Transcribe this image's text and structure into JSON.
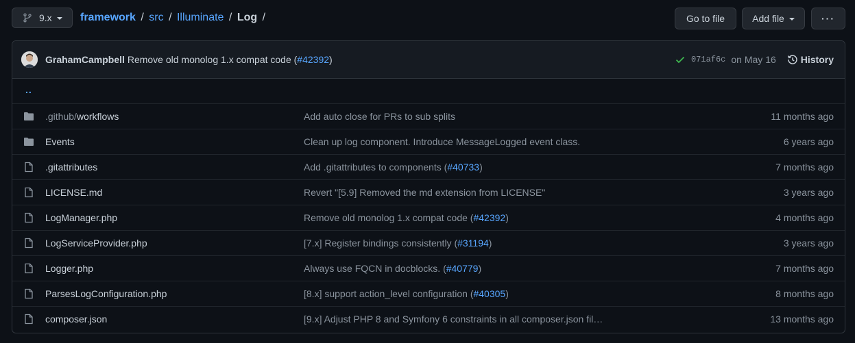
{
  "branch": {
    "label": "9.x",
    "icon": "git-branch-icon"
  },
  "breadcrumb": {
    "repo": "framework",
    "parts": [
      "src",
      "Illuminate"
    ],
    "current": "Log",
    "sep": "/"
  },
  "actions": {
    "go_to_file": "Go to file",
    "add_file": "Add file",
    "more": "···"
  },
  "commit": {
    "author": "GrahamCampbell",
    "message": "Remove old monolog 1.x compat code (",
    "pr": "#42392",
    "message_end": ")",
    "sha": "071af6c",
    "date": "on May 16",
    "history": "History"
  },
  "up": "..",
  "files": [
    {
      "type": "dir",
      "dim": ".github/",
      "name": "workflows",
      "msg": "Add auto close for PRs to sub splits",
      "pr": "",
      "msg_end": "",
      "age": "11 months ago"
    },
    {
      "type": "dir",
      "dim": "",
      "name": "Events",
      "msg": "Clean up log component. Introduce MessageLogged event class.",
      "pr": "",
      "msg_end": "",
      "age": "6 years ago"
    },
    {
      "type": "file",
      "dim": "",
      "name": ".gitattributes",
      "msg": "Add .gitattributes to components (",
      "pr": "#40733",
      "msg_end": ")",
      "age": "7 months ago"
    },
    {
      "type": "file",
      "dim": "",
      "name": "LICENSE.md",
      "msg": "Revert \"[5.9] Removed the md extension from LICENSE\"",
      "pr": "",
      "msg_end": "",
      "age": "3 years ago"
    },
    {
      "type": "file",
      "dim": "",
      "name": "LogManager.php",
      "msg": "Remove old monolog 1.x compat code (",
      "pr": "#42392",
      "msg_end": ")",
      "age": "4 months ago"
    },
    {
      "type": "file",
      "dim": "",
      "name": "LogServiceProvider.php",
      "msg": "[7.x] Register bindings consistently (",
      "pr": "#31194",
      "msg_end": ")",
      "age": "3 years ago"
    },
    {
      "type": "file",
      "dim": "",
      "name": "Logger.php",
      "msg": "Always use FQCN in docblocks. (",
      "pr": "#40779",
      "msg_end": ")",
      "age": "7 months ago"
    },
    {
      "type": "file",
      "dim": "",
      "name": "ParsesLogConfiguration.php",
      "msg": "[8.x] support action_level configuration (",
      "pr": "#40305",
      "msg_end": ")",
      "age": "8 months ago"
    },
    {
      "type": "file",
      "dim": "",
      "name": "composer.json",
      "msg": "[9.x] Adjust PHP 8 and Symfony 6 constraints in all composer.json fil…",
      "pr": "",
      "msg_end": "",
      "age": "13 months ago"
    }
  ],
  "colors": {
    "accent": "#58a6ff",
    "success": "#3fb950",
    "bg": "#0d1117"
  }
}
